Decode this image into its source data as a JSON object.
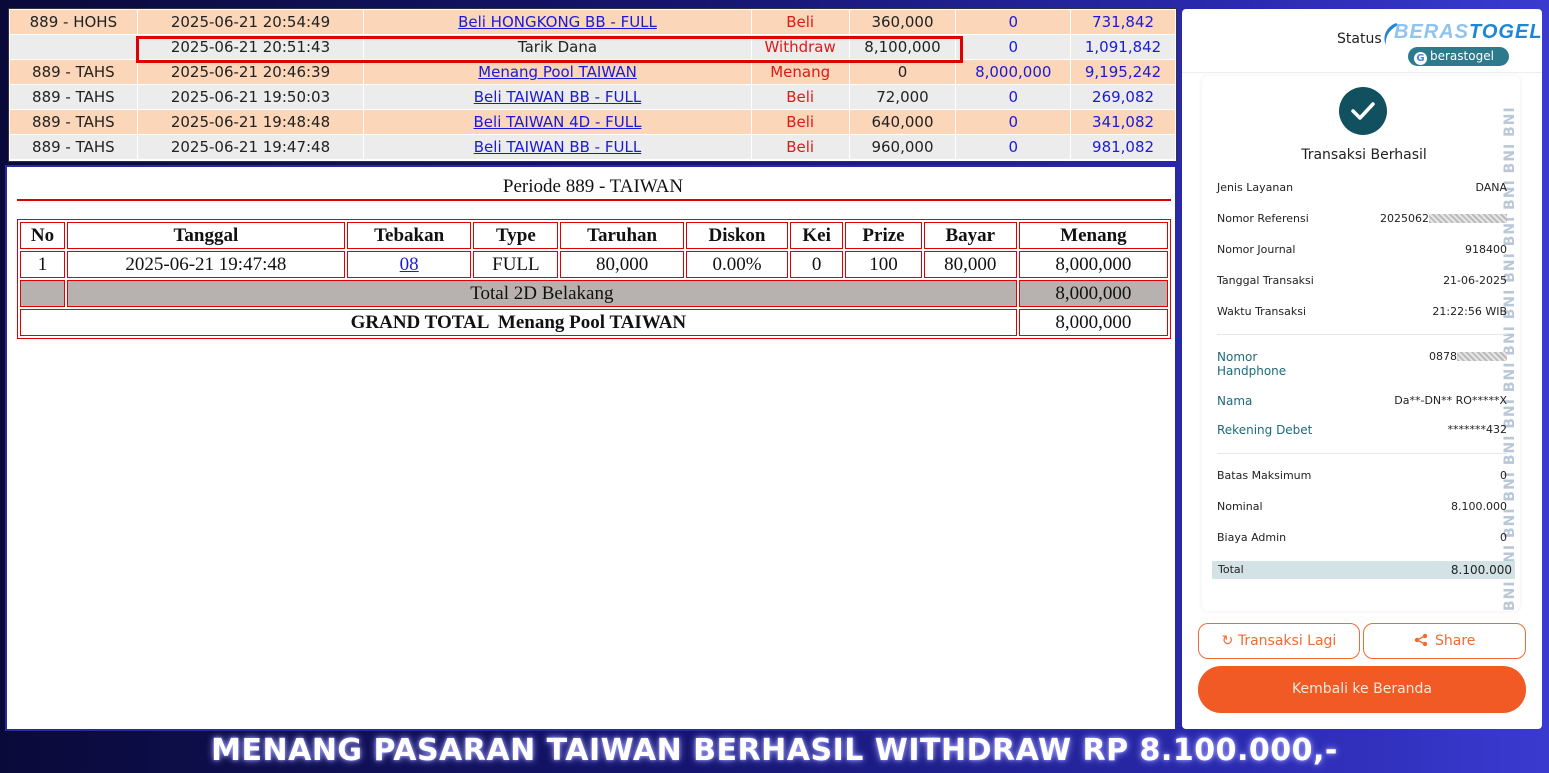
{
  "transactions": [
    {
      "code": "889 - HOHS",
      "date": "2025-06-21 20:54:49",
      "desc": "Beli HONGKONG BB - FULL",
      "type": "Beli",
      "amount": "360,000",
      "win": "0",
      "balance": "731,842"
    },
    {
      "code": "",
      "date": "2025-06-21 20:51:43",
      "desc": "Tarik Dana",
      "type": "Withdraw",
      "amount": "8,100,000",
      "win": "0",
      "balance": "1,091,842"
    },
    {
      "code": "889 - TAHS",
      "date": "2025-06-21 20:46:39",
      "desc": "Menang Pool TAIWAN",
      "type": "Menang",
      "amount": "0",
      "win": "8,000,000",
      "balance": "9,195,242"
    },
    {
      "code": "889 - TAHS",
      "date": "2025-06-21 19:50:03",
      "desc": "Beli TAIWAN BB - FULL",
      "type": "Beli",
      "amount": "72,000",
      "win": "0",
      "balance": "269,082"
    },
    {
      "code": "889 - TAHS",
      "date": "2025-06-21 19:48:48",
      "desc": "Beli TAIWAN 4D - FULL",
      "type": "Beli",
      "amount": "640,000",
      "win": "0",
      "balance": "341,082"
    },
    {
      "code": "889 - TAHS",
      "date": "2025-06-21 19:47:48",
      "desc": "Beli TAIWAN BB - FULL",
      "type": "Beli",
      "amount": "960,000",
      "win": "0",
      "balance": "981,082"
    }
  ],
  "period": {
    "title": "Periode 889 - TAIWAN",
    "headers": [
      "No",
      "Tanggal",
      "Tebakan",
      "Type",
      "Taruhan",
      "Diskon",
      "Kei",
      "Prize",
      "Bayar",
      "Menang"
    ],
    "row": {
      "no": "1",
      "tanggal": "2025-06-21 19:47:48",
      "tebakan": "08",
      "type": "FULL",
      "taruhan": "80,000",
      "diskon": "0.00%",
      "kei": "0",
      "prize": "100",
      "bayar": "80,000",
      "menang": "8,000,000"
    },
    "subtotal_label": "Total 2D Belakang",
    "subtotal_value": "8,000,000",
    "grand_label": "GRAND TOTAL  Menang Pool TAIWAN",
    "grand_value": "8,000,000"
  },
  "receipt": {
    "status_label": "Status",
    "logo_part1": "BERAS",
    "logo_part2": "TOGEL",
    "pill_text": "berastogel",
    "title": "Transaksi Berhasil",
    "rows": [
      {
        "k": "Jenis Layanan",
        "v": "DANA"
      },
      {
        "k": "Nomor Referensi",
        "v": "2025062"
      },
      {
        "k": "Nomor Journal",
        "v": "918400"
      },
      {
        "k": "Tanggal Transaksi",
        "v": "21-06-2025"
      },
      {
        "k": "Waktu Transaksi",
        "v": "21:22:56 WIB"
      }
    ],
    "customer": [
      {
        "k": "Nomor Handphone",
        "v": "0878"
      },
      {
        "k": "Nama",
        "v": "Da**-DN** RO*****X"
      },
      {
        "k": "Rekening Debet",
        "v": "*******432"
      }
    ],
    "amounts": [
      {
        "k": "Batas Maksimum",
        "v": "0"
      },
      {
        "k": "Nominal",
        "v": "8.100.000"
      },
      {
        "k": "Biaya Admin",
        "v": "0"
      }
    ],
    "total_label": "Total",
    "total_value": "8.100.000",
    "watermark": "BNI BNI BNI BNI BNI BNI BNI BNI BNI BNI BNI BNI BNI BNI",
    "btn_again": "Transaksi Lagi",
    "btn_share": "Share",
    "btn_home": "Kembali ke Beranda"
  },
  "banner": "MENANG PASARAN TAIWAN BERHASIL WITHDRAW RP 8.100.000,-",
  "colors": {
    "accent_orange": "#f15a24",
    "teal": "#11505e",
    "highlight_red": "#e00000",
    "link_blue": "#1a1ad8"
  }
}
